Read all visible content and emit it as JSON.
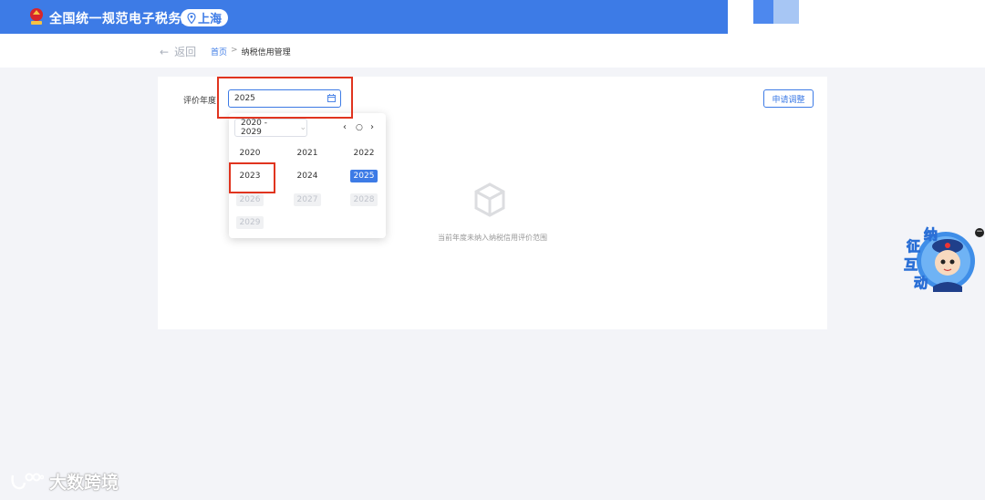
{
  "header": {
    "site_title": "全国统一规范电子税务局",
    "region": "上海",
    "colors": {
      "brand": "#3d7be6"
    }
  },
  "breadcrumb": {
    "back_label": "返回",
    "home": "首页",
    "separator": ">",
    "current": "纳税信用管理"
  },
  "form": {
    "year_label": "评价年度",
    "year_value": "2025",
    "apply_button": "申请调整"
  },
  "year_picker": {
    "range": "2020 - 2029",
    "years": [
      {
        "label": "2020",
        "state": "normal"
      },
      {
        "label": "2021",
        "state": "normal"
      },
      {
        "label": "2022",
        "state": "normal"
      },
      {
        "label": "2023",
        "state": "normal"
      },
      {
        "label": "2024",
        "state": "normal"
      },
      {
        "label": "2025",
        "state": "selected"
      },
      {
        "label": "2026",
        "state": "disabled"
      },
      {
        "label": "2027",
        "state": "disabled"
      },
      {
        "label": "2028",
        "state": "disabled"
      },
      {
        "label": "2029",
        "state": "disabled"
      }
    ]
  },
  "empty_state": {
    "message": "当前年度未纳入纳税信用评价范围"
  },
  "mascot": {
    "text": "征纳互动"
  },
  "watermark": {
    "text": "大数跨境"
  }
}
